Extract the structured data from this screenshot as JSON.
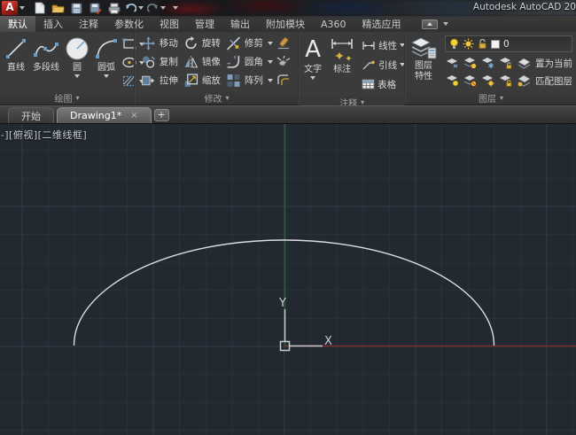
{
  "titlebar": {
    "title": "Autodesk AutoCAD 20"
  },
  "tabs": {
    "items": [
      {
        "label": "默认",
        "active": true
      },
      {
        "label": "插入",
        "active": false
      },
      {
        "label": "注释",
        "active": false
      },
      {
        "label": "参数化",
        "active": false
      },
      {
        "label": "视图",
        "active": false
      },
      {
        "label": "管理",
        "active": false
      },
      {
        "label": "输出",
        "active": false
      },
      {
        "label": "附加模块",
        "active": false
      },
      {
        "label": "A360",
        "active": false
      },
      {
        "label": "精选应用",
        "active": false
      }
    ]
  },
  "ribbon": {
    "draw": {
      "title": "绘图",
      "line": "直线",
      "polyline": "多段线",
      "circle": "圆",
      "arc": "圆弧"
    },
    "modify": {
      "title": "修改",
      "move": "移动",
      "rotate": "旋转",
      "trim": "修剪",
      "copy": "复制",
      "mirror": "镜像",
      "fillet": "圆角",
      "stretch": "拉伸",
      "scale": "缩放",
      "array": "阵列"
    },
    "annotate": {
      "title": "注释",
      "text_icon": "A",
      "text": "文字",
      "dimension": "标注",
      "linear": "线性",
      "leader": "引线",
      "table": "表格"
    },
    "layers": {
      "title": "图层",
      "props_line1": "图层",
      "props_line2": "特性",
      "current_layer": "0",
      "set_current": "置为当前",
      "match_layer": "匹配图层"
    }
  },
  "file_tabs": {
    "start": "开始",
    "drawing": "Drawing1*",
    "close": "×",
    "add": "+"
  },
  "viewport": {
    "controls": "[-][俯视][二维线框]",
    "axis_x": "X",
    "axis_y": "Y"
  },
  "colors": {
    "canvas_bg": "#232931",
    "grid_minor": "#2a313b",
    "grid_major": "#333c47",
    "x_axis_red": "#802d30",
    "y_axis_green": "#2a5f31",
    "arc_white": "#dcdde0",
    "ucs_gray": "#c8cdd3",
    "brand_red": "#a92015"
  }
}
